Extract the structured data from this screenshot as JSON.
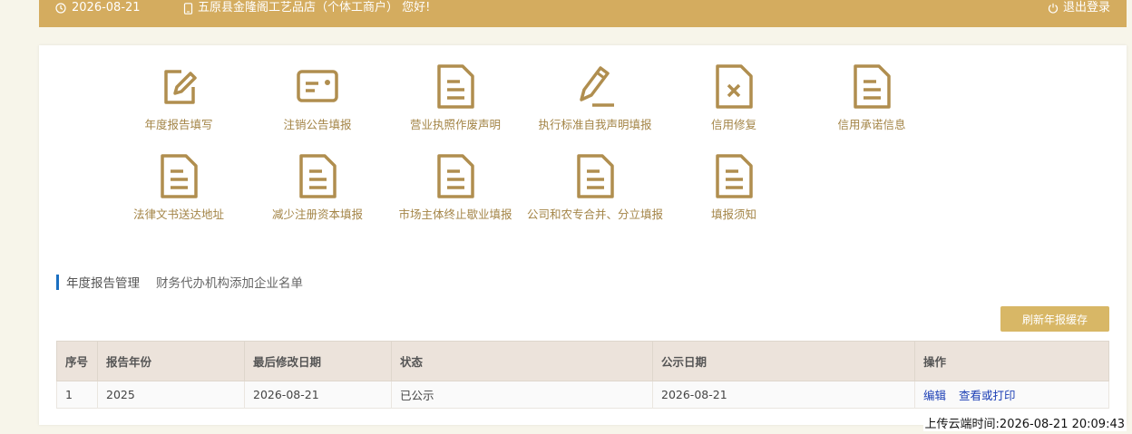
{
  "topbar": {
    "date": "2026-08-21",
    "shop_greeting": "五原县金隆阁工艺品店（个体工商户） 您好!",
    "logout_label": "退出登录",
    "color": "#d4ac5f"
  },
  "shortcuts": [
    {
      "label": "年度报告填写",
      "icon": "edit-icon"
    },
    {
      "label": "注销公告填报",
      "icon": "card-icon"
    },
    {
      "label": "营业执照作废声明",
      "icon": "document-icon"
    },
    {
      "label": "执行标准自我声明填报",
      "icon": "pencil-icon"
    },
    {
      "label": "信用修复",
      "icon": "document-x-icon"
    },
    {
      "label": "信用承诺信息",
      "icon": "document-icon"
    },
    {
      "label": "法律文书送达地址",
      "icon": "document-icon"
    },
    {
      "label": "减少注册资本填报",
      "icon": "document-icon"
    },
    {
      "label": "市场主体终止歇业填报",
      "icon": "document-icon"
    },
    {
      "label": "公司和农专合并、分立填报",
      "icon": "document-icon"
    },
    {
      "label": "填报须知",
      "icon": "document-icon"
    }
  ],
  "section": {
    "tab_active": "年度报告管理",
    "tab_other": "财务代办机构添加企业名单"
  },
  "refresh_label": "刷新年报缓存",
  "table": {
    "headers": [
      "序号",
      "报告年份",
      "最后修改日期",
      "状态",
      "公示日期",
      "操作"
    ],
    "rows": [
      {
        "no": "1",
        "year": "2025",
        "modified": "2026-08-21",
        "status": "已公示",
        "published": "2026-08-21",
        "actions": [
          "编辑",
          "查看或打印"
        ]
      }
    ]
  },
  "upload_time": "上传云端时间:2026-08-21 20:09:43",
  "colors": {
    "accent": "#d4ac5f",
    "icon": "#b08e4f",
    "link": "#1c3fb5",
    "section_bar": "#1b6fc1"
  }
}
